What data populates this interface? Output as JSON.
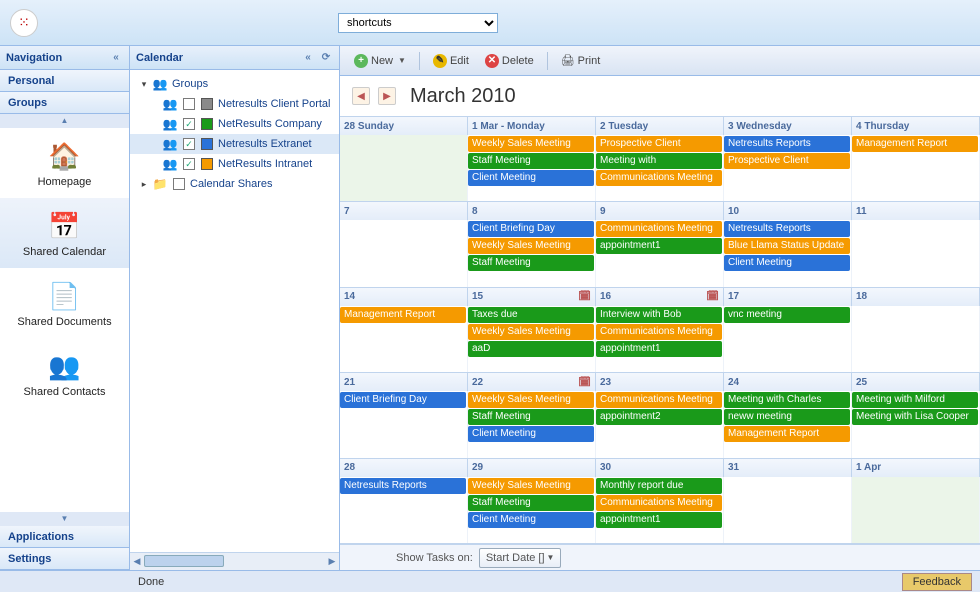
{
  "topbar": {
    "shortcuts_placeholder": "shortcuts"
  },
  "nav": {
    "header": "Navigation",
    "items": [
      {
        "label": "Personal"
      },
      {
        "label": "Groups"
      }
    ],
    "icons": [
      {
        "label": "Homepage",
        "glyph": "🏠",
        "sel": false
      },
      {
        "label": "Shared Calendar",
        "glyph": "📅",
        "sel": true
      },
      {
        "label": "Shared Documents",
        "glyph": "📄",
        "sel": false
      },
      {
        "label": "Shared Contacts",
        "glyph": "👥",
        "sel": false
      }
    ],
    "footer_items": [
      {
        "label": "Applications"
      },
      {
        "label": "Settings"
      }
    ]
  },
  "tree": {
    "header": "Calendar",
    "root": {
      "label": "Groups"
    },
    "children": [
      {
        "label": "Netresults Client Portal",
        "checked": false,
        "color": "#8a8a8a",
        "sel": false
      },
      {
        "label": "NetResults Company",
        "checked": true,
        "color": "#1a9a1a",
        "sel": false
      },
      {
        "label": "Netresults Extranet",
        "checked": true,
        "color": "#2a72d8",
        "sel": true
      },
      {
        "label": "NetResults Intranet",
        "checked": true,
        "color": "#f59a00",
        "sel": false
      }
    ],
    "shares": {
      "label": "Calendar Shares"
    }
  },
  "toolbar": {
    "new": "New",
    "edit": "Edit",
    "delete": "Delete",
    "print": "Print"
  },
  "calTitle": "March 2010",
  "weeks": [
    {
      "days": [
        "28 Sunday",
        "1 Mar - Monday",
        "2 Tuesday",
        "3 Wednesday",
        "4 Thursday"
      ],
      "rec": [
        false,
        false,
        false,
        false,
        false
      ],
      "events": [
        {
          "r": 0,
          "s": 1,
          "e": 2,
          "c": "c-orange",
          "t": "Weekly Sales Meeting"
        },
        {
          "r": 0,
          "s": 2,
          "e": 3,
          "c": "c-orange",
          "t": "Prospective Client"
        },
        {
          "r": 0,
          "s": 3,
          "e": 4,
          "c": "c-blue",
          "t": "Netresults Reports"
        },
        {
          "r": 0,
          "s": 4,
          "e": 5,
          "c": "c-orange",
          "t": "Management Report"
        },
        {
          "r": 1,
          "s": 1,
          "e": 2,
          "c": "c-green",
          "t": "Staff Meeting"
        },
        {
          "r": 1,
          "s": 2,
          "e": 3,
          "c": "c-green",
          "t": "Meeting with"
        },
        {
          "r": 1,
          "s": 3,
          "e": 4,
          "c": "c-orange",
          "t": "Prospective Client"
        },
        {
          "r": 2,
          "s": 1,
          "e": 2,
          "c": "c-blue",
          "t": "Client Meeting"
        },
        {
          "r": 2,
          "s": 2,
          "e": 3,
          "c": "c-orange",
          "t": "Communications Meeting"
        }
      ]
    },
    {
      "days": [
        "7",
        "8",
        "9",
        "10",
        "11"
      ],
      "rec": [
        false,
        false,
        false,
        false,
        false
      ],
      "events": [
        {
          "r": 0,
          "s": 1,
          "e": 2,
          "c": "c-blue",
          "t": "Client Briefing Day"
        },
        {
          "r": 0,
          "s": 2,
          "e": 3,
          "c": "c-orange",
          "t": "Communications Meeting"
        },
        {
          "r": 0,
          "s": 3,
          "e": 4,
          "c": "c-blue",
          "t": "Netresults Reports"
        },
        {
          "r": 1,
          "s": 1,
          "e": 2,
          "c": "c-orange",
          "t": "Weekly Sales Meeting"
        },
        {
          "r": 1,
          "s": 2,
          "e": 3,
          "c": "c-green",
          "t": "appointment1"
        },
        {
          "r": 1,
          "s": 3,
          "e": 4,
          "c": "c-orange",
          "t": "Blue Llama Status Update"
        },
        {
          "r": 2,
          "s": 1,
          "e": 2,
          "c": "c-green",
          "t": "Staff Meeting"
        },
        {
          "r": 2,
          "s": 3,
          "e": 4,
          "c": "c-blue",
          "t": "Client Meeting"
        }
      ]
    },
    {
      "days": [
        "14",
        "15",
        "16",
        "17",
        "18"
      ],
      "rec": [
        false,
        true,
        true,
        false,
        false
      ],
      "events": [
        {
          "r": 0,
          "s": 0,
          "e": 1,
          "c": "c-orange",
          "t": "Management Report"
        },
        {
          "r": 0,
          "s": 1,
          "e": 2,
          "c": "c-green",
          "t": "Taxes due"
        },
        {
          "r": 0,
          "s": 2,
          "e": 3,
          "c": "c-green",
          "t": "Interview with Bob"
        },
        {
          "r": 0,
          "s": 3,
          "e": 4,
          "c": "c-green",
          "t": "vnc meeting"
        },
        {
          "r": 1,
          "s": 1,
          "e": 2,
          "c": "c-orange",
          "t": "Weekly Sales Meeting"
        },
        {
          "r": 1,
          "s": 2,
          "e": 3,
          "c": "c-orange",
          "t": "Communications Meeting"
        },
        {
          "r": 2,
          "s": 1,
          "e": 2,
          "c": "c-green",
          "t": "aaD"
        },
        {
          "r": 2,
          "s": 2,
          "e": 3,
          "c": "c-green",
          "t": "appointment1"
        }
      ]
    },
    {
      "days": [
        "21",
        "22",
        "23",
        "24",
        "25"
      ],
      "rec": [
        false,
        true,
        false,
        false,
        false
      ],
      "events": [
        {
          "r": 0,
          "s": 0,
          "e": 1,
          "c": "c-blue",
          "t": "Client Briefing Day"
        },
        {
          "r": 0,
          "s": 1,
          "e": 2,
          "c": "c-orange",
          "t": "Weekly Sales Meeting"
        },
        {
          "r": 0,
          "s": 2,
          "e": 3,
          "c": "c-orange",
          "t": "Communications Meeting"
        },
        {
          "r": 0,
          "s": 3,
          "e": 4,
          "c": "c-green",
          "t": "Meeting with Charles"
        },
        {
          "r": 0,
          "s": 4,
          "e": 5,
          "c": "c-green",
          "t": "Meeting with Milford"
        },
        {
          "r": 1,
          "s": 1,
          "e": 2,
          "c": "c-green",
          "t": "Staff Meeting"
        },
        {
          "r": 1,
          "s": 2,
          "e": 3,
          "c": "c-green",
          "t": "appointment2"
        },
        {
          "r": 1,
          "s": 3,
          "e": 4,
          "c": "c-green",
          "t": "neww meeting"
        },
        {
          "r": 1,
          "s": 4,
          "e": 5,
          "c": "c-green",
          "t": "Meeting with Lisa Cooper"
        },
        {
          "r": 2,
          "s": 1,
          "e": 2,
          "c": "c-blue",
          "t": "Client Meeting"
        },
        {
          "r": 2,
          "s": 3,
          "e": 4,
          "c": "c-orange",
          "t": "Management Report"
        }
      ]
    },
    {
      "days": [
        "28",
        "29",
        "30",
        "31",
        "1 Apr"
      ],
      "rec": [
        false,
        false,
        false,
        false,
        false
      ],
      "events": [
        {
          "r": 0,
          "s": 0,
          "e": 1,
          "c": "c-blue",
          "t": "Netresults Reports"
        },
        {
          "r": 0,
          "s": 1,
          "e": 2,
          "c": "c-orange",
          "t": "Weekly Sales Meeting"
        },
        {
          "r": 0,
          "s": 2,
          "e": 3,
          "c": "c-green",
          "t": "Monthly report due"
        },
        {
          "r": 1,
          "s": 1,
          "e": 2,
          "c": "c-green",
          "t": "Staff Meeting"
        },
        {
          "r": 1,
          "s": 2,
          "e": 3,
          "c": "c-orange",
          "t": "Communications Meeting"
        },
        {
          "r": 2,
          "s": 1,
          "e": 2,
          "c": "c-blue",
          "t": "Client Meeting"
        },
        {
          "r": 2,
          "s": 2,
          "e": 3,
          "c": "c-green",
          "t": "appointment1"
        }
      ]
    }
  ],
  "bottom": {
    "tasks_label": "Show Tasks on:",
    "startdate": "Start Date []"
  },
  "status": {
    "done": "Done",
    "feedback": "Feedback"
  }
}
